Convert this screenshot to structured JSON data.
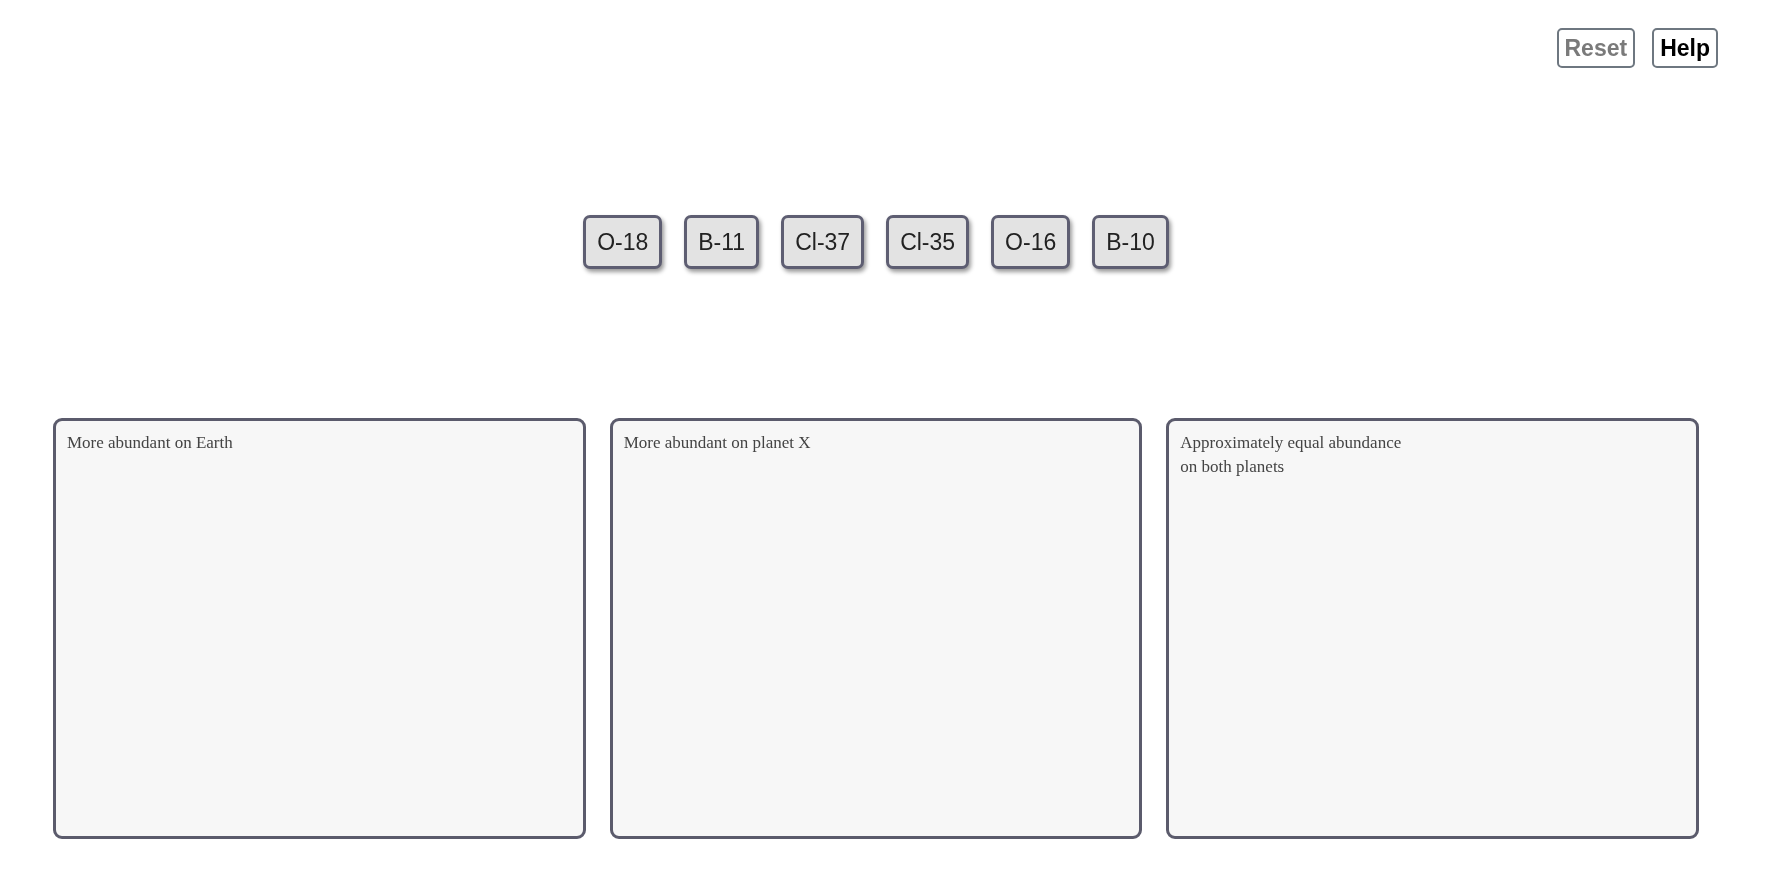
{
  "toolbar": {
    "buttons": [
      {
        "label": "Reset",
        "disabled": true
      },
      {
        "label": "Help",
        "disabled": false
      }
    ]
  },
  "tiles": [
    {
      "label": "O-18"
    },
    {
      "label": "B-11"
    },
    {
      "label": "Cl-37"
    },
    {
      "label": "Cl-35"
    },
    {
      "label": "O-16"
    },
    {
      "label": "B-10"
    }
  ],
  "bins": [
    {
      "label": "More abundant on Earth"
    },
    {
      "label": "More abundant on planet X"
    },
    {
      "label": "Approximately equal abundance on both planets"
    }
  ]
}
